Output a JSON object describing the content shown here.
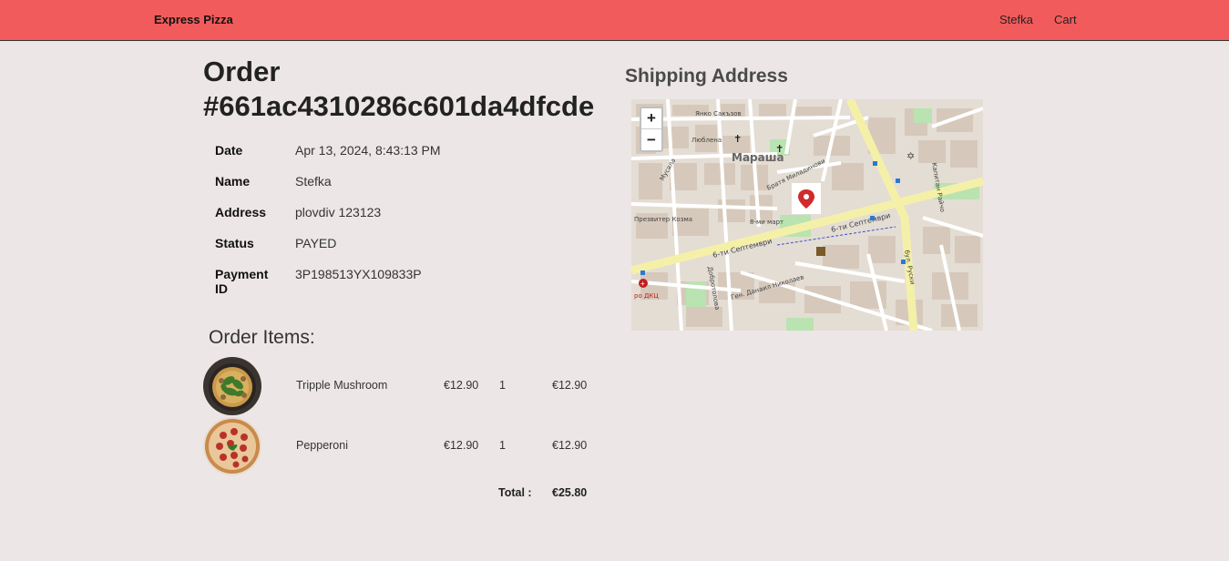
{
  "navbar": {
    "brand": "Express Pizza",
    "user": "Stefka",
    "cart": "Cart"
  },
  "order": {
    "title": "Order #661ac4310286c601da4dfcde",
    "details": [
      {
        "label": "Date",
        "value": "Apr 13, 2024, 8:43:13 PM"
      },
      {
        "label": "Name",
        "value": "Stefka"
      },
      {
        "label": "Address",
        "value": "plovdiv 123123"
      },
      {
        "label": "Status",
        "value": "PAYED"
      },
      {
        "label": "Payment ID",
        "value": "3P198513YX109833P"
      }
    ]
  },
  "items": {
    "title": "Order Items:",
    "rows": [
      {
        "name": "Tripple Mushroom",
        "price": "€12.90",
        "qty": "1",
        "subtotal": "€12.90"
      },
      {
        "name": "Pepperoni",
        "price": "€12.90",
        "qty": "1",
        "subtotal": "€12.90"
      }
    ],
    "total_label": "Total :",
    "total_value": "€25.80"
  },
  "shipping": {
    "title": "Shipping Address",
    "zoom_in": "+",
    "zoom_out": "−",
    "map_labels": {
      "district": "Мараша",
      "street_1": "6-ти Септември",
      "street_2": "6-ти Септември",
      "street_3": "бул. Руски",
      "street_4": "Ген. Данаил Николаев",
      "street_5": "Янко Сакъзов",
      "street_6": "Люблена",
      "street_7": "8-ми март",
      "street_8": "Презвитер Козма",
      "street_9": "Братя Миладинови",
      "street_10": "Добротолова",
      "street_11": "Мусала",
      "street_12": "Капитан Райчо",
      "street_13": "ро ДКЦ"
    }
  }
}
